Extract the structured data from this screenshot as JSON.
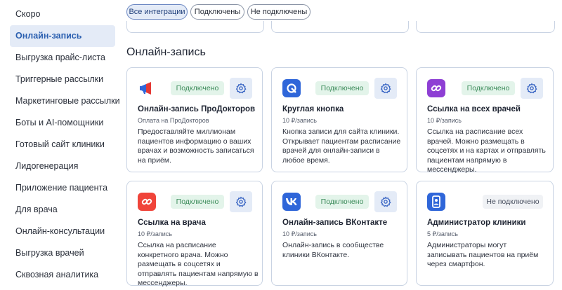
{
  "sidebar": {
    "items": [
      {
        "label": "Скоро"
      },
      {
        "label": "Онлайн-запись"
      },
      {
        "label": "Выгрузка прайс-листа"
      },
      {
        "label": "Триггерные рассылки"
      },
      {
        "label": "Маркетинговые рассылки"
      },
      {
        "label": "Боты и AI-помощники"
      },
      {
        "label": "Готовый сайт клиники"
      },
      {
        "label": "Лидогенерация"
      },
      {
        "label": "Приложение пациента"
      },
      {
        "label": "Для врача"
      },
      {
        "label": "Онлайн-консультации"
      },
      {
        "label": "Выгрузка врачей"
      },
      {
        "label": "Сквозная аналитика"
      }
    ]
  },
  "filters": [
    {
      "label": "Все интеграции"
    },
    {
      "label": "Подключены"
    },
    {
      "label": "Не подключены"
    }
  ],
  "section": {
    "title": "Онлайн-запись"
  },
  "colors": {
    "accent": "#2a5fb0",
    "connected_bg": "#e3f4ea",
    "connected_text": "#3d8c5b"
  },
  "cards": [
    {
      "name": "Онлайн-запись ПроДокторов",
      "price": "Оплата на ПроДокторов",
      "status": "Подключено",
      "icon": "megaphone-icon",
      "description": "Предоставляйте миллионам пациентов информацию о ваших врачах и возможность записаться на приём."
    },
    {
      "name": "Круглая кнопка",
      "price": "10 ₽/запись",
      "status": "Подключено",
      "icon": "round-button-icon",
      "description": "Кнопка записи для сайта клиники. Открывает пациентам расписание врачей для онлайн-записи в любое время."
    },
    {
      "name": "Ссылка на всех врачей",
      "price": "10 ₽/запись",
      "status": "Подключено",
      "icon": "link-icon",
      "description": "Ссылка на расписание всех врачей. Можно размещать в соцсетях и на картах и отправлять пациентам напрямую в мессенджеры."
    },
    {
      "name": "Ссылка на врача",
      "price": "10 ₽/запись",
      "status": "Подключено",
      "icon": "link-icon",
      "description": "Ссылка на расписание конкретного врача. Можно размещать в соцсетях и отправлять пациентам напрямую в мессенджеры."
    },
    {
      "name": "Онлайн-запись ВКонтакте",
      "price": "10 ₽/запись",
      "status": "Подключено",
      "icon": "vk-icon",
      "description": "Онлайн-запись в сообществе клиники ВКонтакте."
    },
    {
      "name": "Администратор клиники",
      "price": "5 ₽/запись",
      "status": "Не подключено",
      "icon": "admin-icon",
      "description": "Администраторы могут записывать пациентов на приём через смартфон."
    }
  ]
}
